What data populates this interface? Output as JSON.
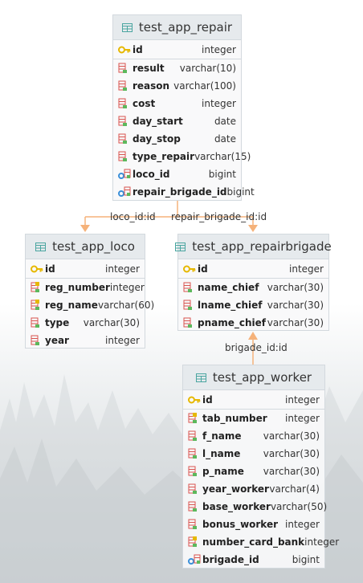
{
  "tables": [
    {
      "id": "repair",
      "title": "test_app_repair",
      "columns": [
        {
          "name": "id",
          "type": "integer",
          "kind": "pk"
        },
        {
          "name": "result",
          "type": "varchar(10)",
          "kind": "col"
        },
        {
          "name": "reason",
          "type": "varchar(100)",
          "kind": "col"
        },
        {
          "name": "cost",
          "type": "integer",
          "kind": "col"
        },
        {
          "name": "day_start",
          "type": "date",
          "kind": "col"
        },
        {
          "name": "day_stop",
          "type": "date",
          "kind": "col"
        },
        {
          "name": "type_repair",
          "type": "varchar(15)",
          "kind": "col"
        },
        {
          "name": "loco_id",
          "type": "bigint",
          "kind": "fk"
        },
        {
          "name": "repair_brigade_id",
          "type": "bigint",
          "kind": "fk"
        }
      ]
    },
    {
      "id": "loco",
      "title": "test_app_loco",
      "columns": [
        {
          "name": "id",
          "type": "integer",
          "kind": "pk"
        },
        {
          "name": "reg_number",
          "type": "integer",
          "kind": "uniq"
        },
        {
          "name": "reg_name",
          "type": "varchar(60)",
          "kind": "uniq"
        },
        {
          "name": "type",
          "type": "varchar(30)",
          "kind": "col"
        },
        {
          "name": "year",
          "type": "integer",
          "kind": "col"
        }
      ]
    },
    {
      "id": "repairbrigade",
      "title": "test_app_repairbrigade",
      "columns": [
        {
          "name": "id",
          "type": "integer",
          "kind": "pk"
        },
        {
          "name": "name_chief",
          "type": "varchar(30)",
          "kind": "col"
        },
        {
          "name": "lname_chief",
          "type": "varchar(30)",
          "kind": "col"
        },
        {
          "name": "pname_chief",
          "type": "varchar(30)",
          "kind": "col"
        }
      ]
    },
    {
      "id": "worker",
      "title": "test_app_worker",
      "columns": [
        {
          "name": "id",
          "type": "integer",
          "kind": "pk"
        },
        {
          "name": "tab_number",
          "type": "integer",
          "kind": "uniq"
        },
        {
          "name": "f_name",
          "type": "varchar(30)",
          "kind": "col"
        },
        {
          "name": "l_name",
          "type": "varchar(30)",
          "kind": "col"
        },
        {
          "name": "p_name",
          "type": "varchar(30)",
          "kind": "col"
        },
        {
          "name": "year_worker",
          "type": "varchar(4)",
          "kind": "col"
        },
        {
          "name": "base_worker",
          "type": "varchar(50)",
          "kind": "col"
        },
        {
          "name": "bonus_worker",
          "type": "integer",
          "kind": "col"
        },
        {
          "name": "number_card_bank",
          "type": "integer",
          "kind": "uniq"
        },
        {
          "name": "brigade_id",
          "type": "bigint",
          "kind": "fk"
        }
      ]
    }
  ],
  "relations": {
    "loco": "loco_id:id",
    "repair_brigade": "repair_brigade_id:id",
    "brigade": "brigade_id:id"
  },
  "colors": {
    "connector": "#f5b27a",
    "table_icon": "#4aa5a0",
    "pk_key": "#e6b800",
    "column_icon": "#d9534f"
  }
}
